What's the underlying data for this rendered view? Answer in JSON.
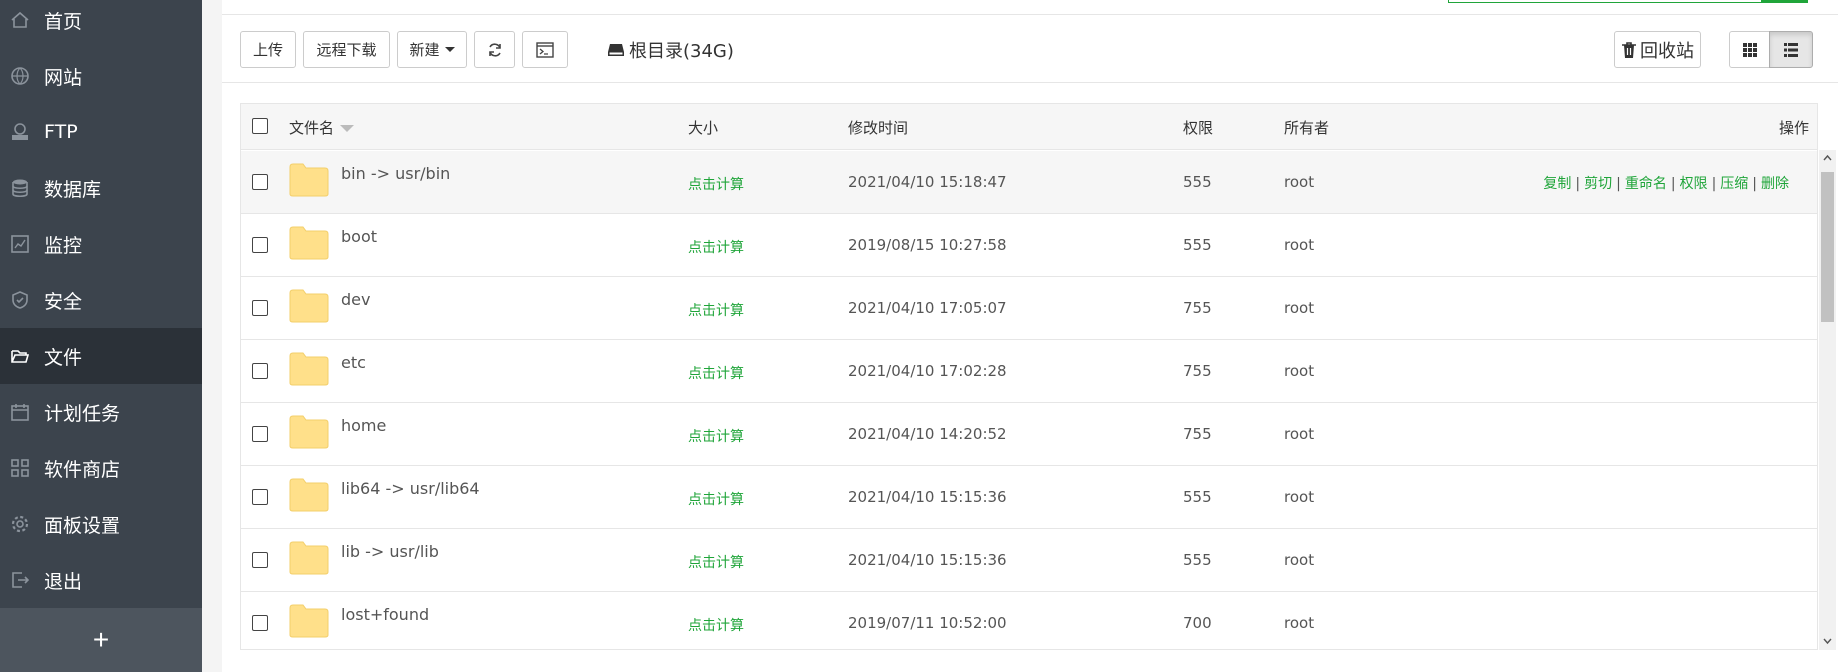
{
  "sidebar": {
    "items": [
      {
        "label": "首页",
        "icon": "home-icon",
        "active": false
      },
      {
        "label": "网站",
        "icon": "globe-icon",
        "active": false
      },
      {
        "label": "FTP",
        "icon": "ftp-icon",
        "active": false
      },
      {
        "label": "数据库",
        "icon": "database-icon",
        "active": false
      },
      {
        "label": "监控",
        "icon": "monitor-icon",
        "active": false
      },
      {
        "label": "安全",
        "icon": "shield-icon",
        "active": false
      },
      {
        "label": "文件",
        "icon": "folder-open-icon",
        "active": true
      },
      {
        "label": "计划任务",
        "icon": "calendar-icon",
        "active": false
      },
      {
        "label": "软件商店",
        "icon": "grid-apps-icon",
        "active": false
      },
      {
        "label": "面板设置",
        "icon": "gear-icon",
        "active": false
      },
      {
        "label": "退出",
        "icon": "logout-icon",
        "active": false
      }
    ],
    "add_label": "+"
  },
  "toolbar": {
    "upload": "上传",
    "remote_download": "远程下载",
    "new": "新建",
    "refresh_icon": "refresh-icon",
    "terminal_icon": "terminal-icon",
    "root_dir": "根目录(34G)",
    "recycle_bin": "回收站"
  },
  "table": {
    "headers": {
      "name": "文件名",
      "size": "大小",
      "mtime": "修改时间",
      "perm": "权限",
      "owner": "所有者",
      "ops": "操作"
    },
    "rows": [
      {
        "name": "bin -> usr/bin",
        "size": "点击计算",
        "mtime": "2021/04/10 15:18:47",
        "perm": "555",
        "owner": "root"
      },
      {
        "name": "boot",
        "size": "点击计算",
        "mtime": "2019/08/15 10:27:58",
        "perm": "555",
        "owner": "root"
      },
      {
        "name": "dev",
        "size": "点击计算",
        "mtime": "2021/04/10 17:05:07",
        "perm": "755",
        "owner": "root"
      },
      {
        "name": "etc",
        "size": "点击计算",
        "mtime": "2021/04/10 17:02:28",
        "perm": "755",
        "owner": "root"
      },
      {
        "name": "home",
        "size": "点击计算",
        "mtime": "2021/04/10 14:20:52",
        "perm": "755",
        "owner": "root"
      },
      {
        "name": "lib64 -> usr/lib64",
        "size": "点击计算",
        "mtime": "2021/04/10 15:15:36",
        "perm": "555",
        "owner": "root"
      },
      {
        "name": "lib -> usr/lib",
        "size": "点击计算",
        "mtime": "2021/04/10 15:15:36",
        "perm": "555",
        "owner": "root"
      },
      {
        "name": "lost+found",
        "size": "点击计算",
        "mtime": "2019/07/11 10:52:00",
        "perm": "700",
        "owner": "root"
      }
    ],
    "row_actions": [
      "复制",
      "剪切",
      "重命名",
      "权限",
      "压缩",
      "删除"
    ]
  },
  "colors": {
    "accent": "#20a53a",
    "sidebar_bg": "#3c444d",
    "sidebar_active": "#2b3138",
    "folder": "#ffe08a"
  }
}
